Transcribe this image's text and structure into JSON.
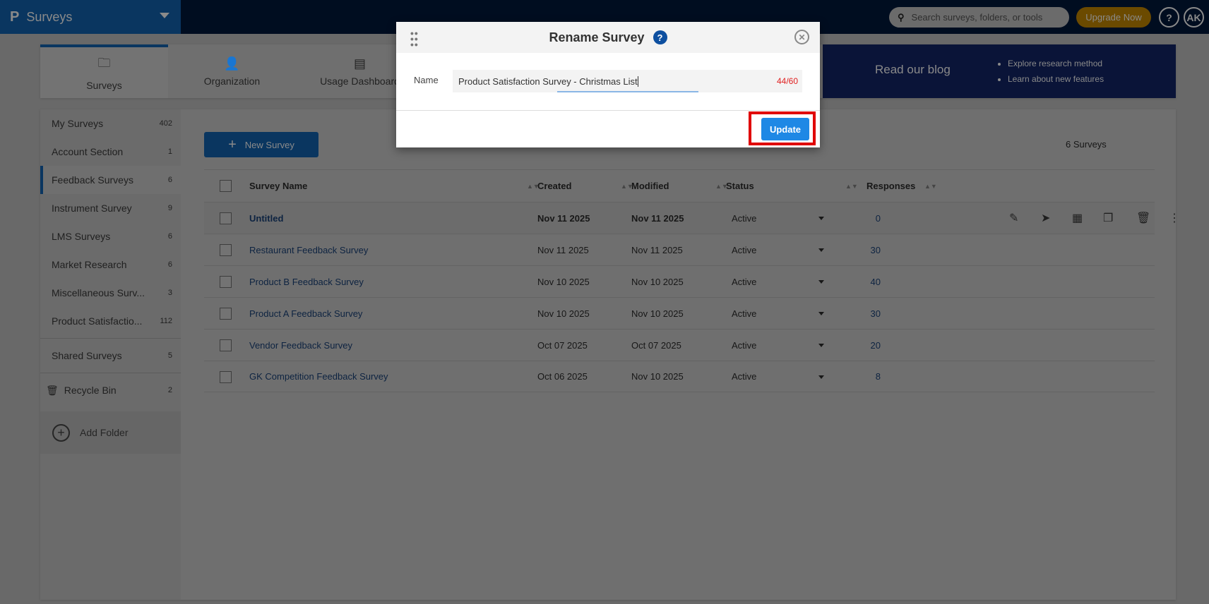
{
  "topbar": {
    "brand": "Surveys",
    "logo": "P",
    "search_placeholder": "Search surveys, folders, or tools",
    "upgrade": "Upgrade Now",
    "help": "?",
    "avatar": "AK"
  },
  "tabs": [
    {
      "label": "Surveys",
      "icon": "folder-icon"
    },
    {
      "label": "Organization",
      "icon": "user-add-icon"
    },
    {
      "label": "Usage Dashboard",
      "icon": "dashboard-icon"
    }
  ],
  "blog": {
    "title": "Read our blog",
    "items": [
      "Explore research method",
      "Learn about new features"
    ]
  },
  "sidebar": {
    "items": [
      {
        "label": "My Surveys",
        "count": "402"
      },
      {
        "label": "Account Section",
        "count": "1"
      },
      {
        "label": "Feedback Surveys",
        "count": "6",
        "active": true
      },
      {
        "label": "Instrument Survey",
        "count": "9"
      },
      {
        "label": "LMS Surveys",
        "count": "6"
      },
      {
        "label": "Market Research",
        "count": "6"
      },
      {
        "label": "Miscellaneous Surv...",
        "count": "3"
      },
      {
        "label": "Product Satisfactio...",
        "count": "112"
      }
    ],
    "shared": {
      "label": "Shared Surveys",
      "count": "5"
    },
    "recycle": {
      "label": "Recycle Bin",
      "count": "2"
    },
    "add_folder": "Add Folder"
  },
  "main": {
    "new_survey": "New Survey",
    "count": "6 Surveys"
  },
  "table": {
    "headers": {
      "name": "Survey Name",
      "created": "Created",
      "modified": "Modified",
      "status": "Status",
      "responses": "Responses"
    },
    "rows": [
      {
        "name": "Untitled",
        "created": "Nov 11 2025",
        "modified": "Nov 11 2025",
        "status": "Active",
        "responses": "0"
      },
      {
        "name": "Restaurant Feedback Survey",
        "created": "Nov 11 2025",
        "modified": "Nov 11 2025",
        "status": "Active",
        "responses": "30"
      },
      {
        "name": "Product B Feedback Survey",
        "created": "Nov 10 2025",
        "modified": "Nov 10 2025",
        "status": "Active",
        "responses": "40"
      },
      {
        "name": "Product A Feedback Survey",
        "created": "Nov 10 2025",
        "modified": "Nov 10 2025",
        "status": "Active",
        "responses": "30"
      },
      {
        "name": "Vendor Feedback Survey",
        "created": "Oct 07 2025",
        "modified": "Oct 07 2025",
        "status": "Active",
        "responses": "20"
      },
      {
        "name": "GK Competition Feedback Survey",
        "created": "Oct 06 2025",
        "modified": "Nov 10 2025",
        "status": "Active",
        "responses": "8"
      }
    ]
  },
  "modal": {
    "title": "Rename Survey",
    "name_label": "Name",
    "name_value": "Product Satisfaction Survey - Christmas List",
    "char_count": "44/60",
    "update": "Update"
  },
  "colors": {
    "brand": "#1678d5",
    "topbar": "#001845",
    "upgrade": "#eea500",
    "highlight": "#e00000",
    "update": "#1e88e5"
  }
}
